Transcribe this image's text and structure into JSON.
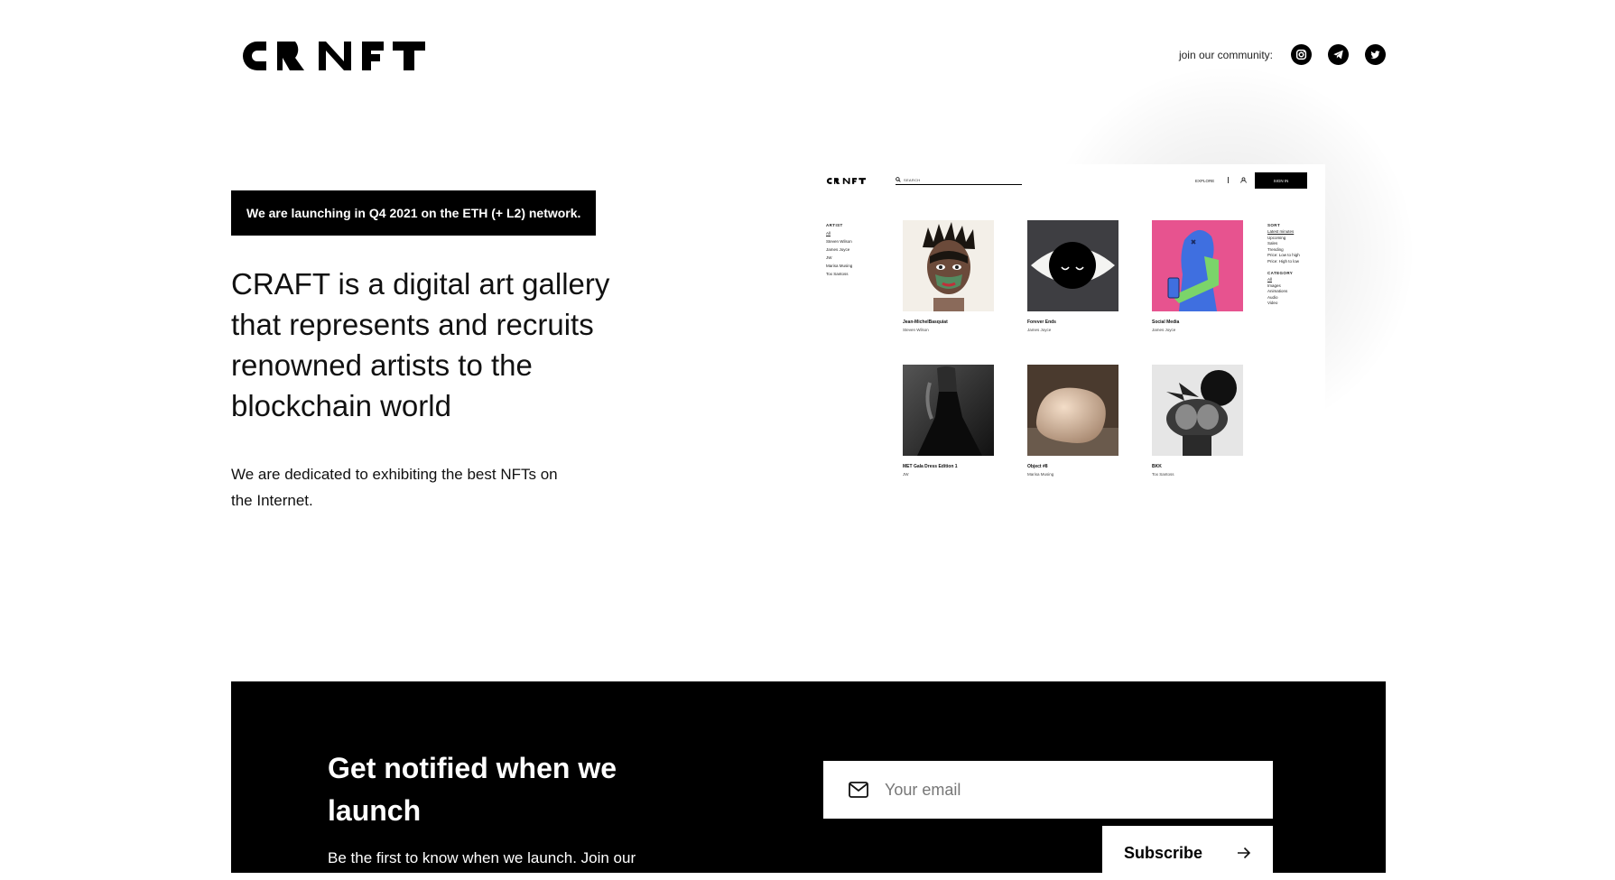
{
  "header": {
    "logo_text": "CRAFT",
    "community_label": "join our community:",
    "social": [
      "instagram-icon",
      "telegram-icon",
      "twitter-icon"
    ]
  },
  "hero": {
    "badge": "We are launching in Q4 2021 on the ETH (+ L2) network.",
    "headline": "CRAFT is a digital art gallery that represents and recruits renowned artists to the blockchain world",
    "subtext": "We are dedicated to exhibiting the best NFTs on the Internet."
  },
  "mockup": {
    "logo_text": "CRAFT",
    "search_placeholder": "SEARCH",
    "explore": "EXPLORE",
    "sign_in": "SIGN IN",
    "artist": {
      "heading": "ARTIST",
      "items": [
        "All",
        "Steven Wilson",
        "James Joyce",
        "JW",
        "Marisa Musing",
        "Tox Santoss"
      ]
    },
    "sort": {
      "heading": "SORT",
      "items": [
        "Latest minutes",
        "Upcoming",
        "Sales",
        "Trending",
        "Price: Low to high",
        "Price: High to low"
      ]
    },
    "category": {
      "heading": "CATEGORY",
      "items": [
        "All",
        "Images",
        "Animations",
        "Audio",
        "Video"
      ]
    },
    "cards": [
      {
        "title": "Jean-MichelBasquiat",
        "artist": "Steven Wilson"
      },
      {
        "title": "Forever Ends",
        "artist": "James Joyce"
      },
      {
        "title": "Social Media",
        "artist": "James Joyce"
      },
      {
        "title": "MET Gala Dress Edition 1",
        "artist": "JW"
      },
      {
        "title": "Object #8",
        "artist": "Marisa Musing"
      },
      {
        "title": "BKK",
        "artist": "Tox Santoss"
      }
    ]
  },
  "notify": {
    "title": "Get notified when we launch",
    "description": "Be the first to know when we launch. Join our",
    "email_placeholder": "Your email",
    "subscribe_label": "Subscribe"
  }
}
